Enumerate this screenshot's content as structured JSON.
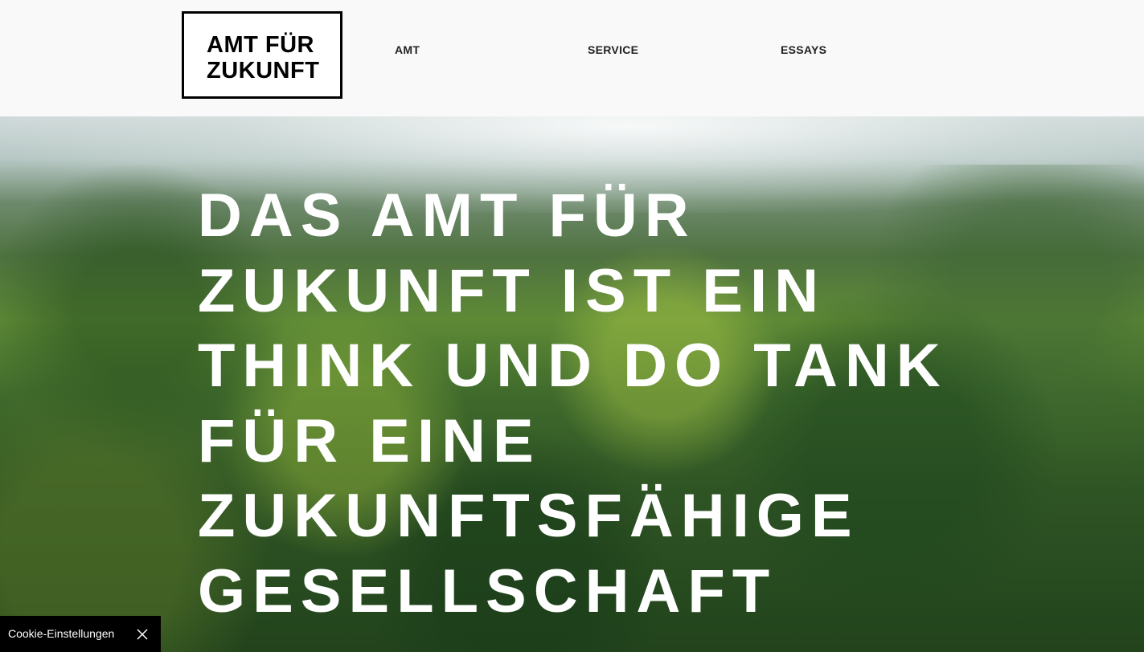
{
  "header": {
    "logo": {
      "line1": "AMT FÜR",
      "line2": "ZUKUNFT"
    },
    "nav": [
      {
        "label": "AMT"
      },
      {
        "label": "SERVICE"
      },
      {
        "label": "ESSAYS"
      }
    ]
  },
  "hero": {
    "lines": [
      "DAS AMT FÜR",
      "ZUKUNFT IST EIN",
      "THINK UND DO TANK",
      "FÜR EINE",
      "ZUKUNFTSFÄHIGE",
      "GESELLSCHAFT"
    ],
    "background": "forest-aerial-photo"
  },
  "cookie_bar": {
    "label": "Cookie-Einstellungen",
    "close_icon": "close-icon"
  },
  "colors": {
    "header_bg": "#f9f9f9",
    "logo_border": "#000000",
    "nav_text": "#222222",
    "hero_text": "#ffffff",
    "cookie_bg": "#000000"
  }
}
